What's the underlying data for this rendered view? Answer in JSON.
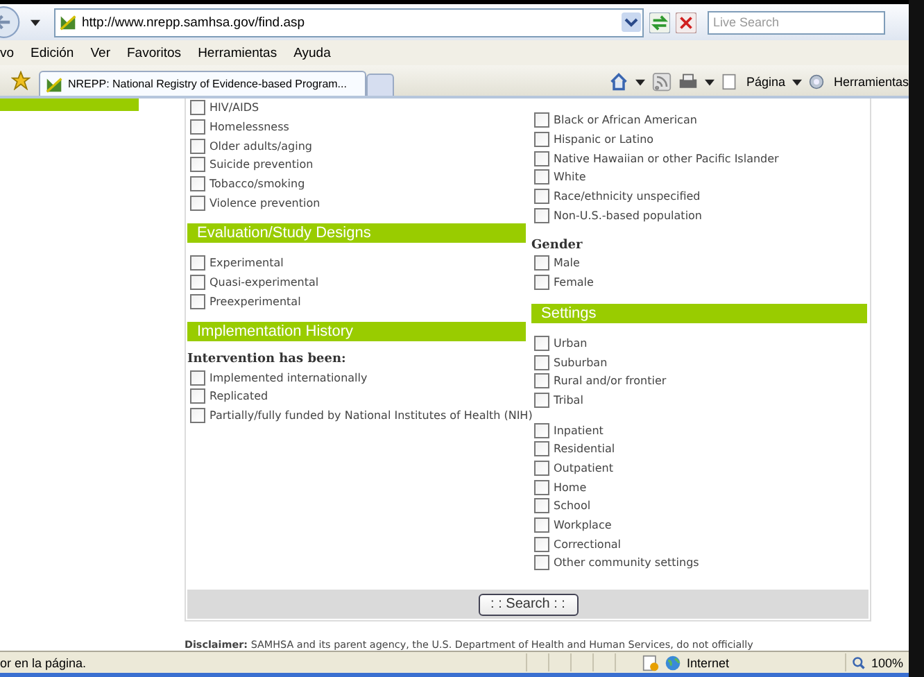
{
  "address_bar": {
    "url": "http://www.nrepp.samhsa.gov/find.asp",
    "search_placeholder": "Live Search"
  },
  "menu": [
    "vo",
    "Edición",
    "Ver",
    "Favoritos",
    "Herramientas",
    "Ayuda"
  ],
  "tabs": [
    {
      "label": "NREPP: National Registry of Evidence-based Program...",
      "selected": true
    },
    {
      "selected": false
    }
  ],
  "command_bar": {
    "page": "Página",
    "tools": "Herramientas"
  },
  "left_column": [
    {
      "kind": "checks",
      "items": [
        {
          "label": "HIV/AIDS",
          "checked": false
        },
        {
          "label": "Homelessness",
          "checked": false
        },
        {
          "label": "Older adults/aging",
          "checked": false
        },
        {
          "label": "Suicide prevention",
          "checked": false
        },
        {
          "label": "Tobacco/smoking",
          "checked": false
        },
        {
          "label": "Violence prevention",
          "checked": false
        }
      ]
    },
    {
      "kind": "header",
      "text": "Evaluation/Study Designs"
    },
    {
      "kind": "checks",
      "items": [
        {
          "label": "Experimental",
          "checked": false
        },
        {
          "label": "Quasi-experimental",
          "checked": false
        },
        {
          "label": "Preexperimental",
          "checked": false
        }
      ]
    },
    {
      "kind": "header",
      "text": "Implementation History"
    },
    {
      "kind": "label",
      "text": "Intervention has been:"
    },
    {
      "kind": "checks",
      "items": [
        {
          "label": "Implemented internationally",
          "checked": false
        },
        {
          "label": "Replicated",
          "checked": false
        },
        {
          "label": "Partially/fully funded by National Institutes of Health (NIH)",
          "checked": false
        }
      ]
    }
  ],
  "right_column": [
    {
      "kind": "checks",
      "items": [
        {
          "label": "Black or African American",
          "checked": false
        },
        {
          "label": "Hispanic or Latino",
          "checked": false
        },
        {
          "label": "Native Hawaiian or other Pacific Islander",
          "checked": false
        },
        {
          "label": "White",
          "checked": false
        },
        {
          "label": "Race/ethnicity unspecified",
          "checked": false
        },
        {
          "label": "Non-U.S.-based population",
          "checked": false
        }
      ]
    },
    {
      "kind": "label",
      "text": "Gender"
    },
    {
      "kind": "checks",
      "items": [
        {
          "label": "Male",
          "checked": false
        },
        {
          "label": "Female",
          "checked": false
        }
      ]
    },
    {
      "kind": "header",
      "text": "Settings"
    },
    {
      "kind": "checks",
      "items": [
        {
          "label": "Urban",
          "checked": false
        },
        {
          "label": "Suburban",
          "checked": false
        },
        {
          "label": "Rural and/or frontier",
          "checked": false
        },
        {
          "label": "Tribal",
          "checked": false
        }
      ]
    },
    {
      "kind": "checks",
      "items": [
        {
          "label": "Inpatient",
          "checked": false
        },
        {
          "label": "Residential",
          "checked": false
        },
        {
          "label": "Outpatient",
          "checked": false
        },
        {
          "label": "Home",
          "checked": false
        },
        {
          "label": "School",
          "checked": false
        },
        {
          "label": "Workplace",
          "checked": false
        },
        {
          "label": "Correctional",
          "checked": false
        },
        {
          "label": "Other community settings",
          "checked": false
        }
      ]
    }
  ],
  "search_button": ": : Search : :",
  "disclaimer": {
    "label": "Disclaimer:",
    "text": "SAMHSA and its parent agency, the U.S. Department of Health and Human Services, do not officially"
  },
  "status_bar": {
    "text": "or en la página.",
    "zone": "Internet",
    "zoom": "100%"
  }
}
